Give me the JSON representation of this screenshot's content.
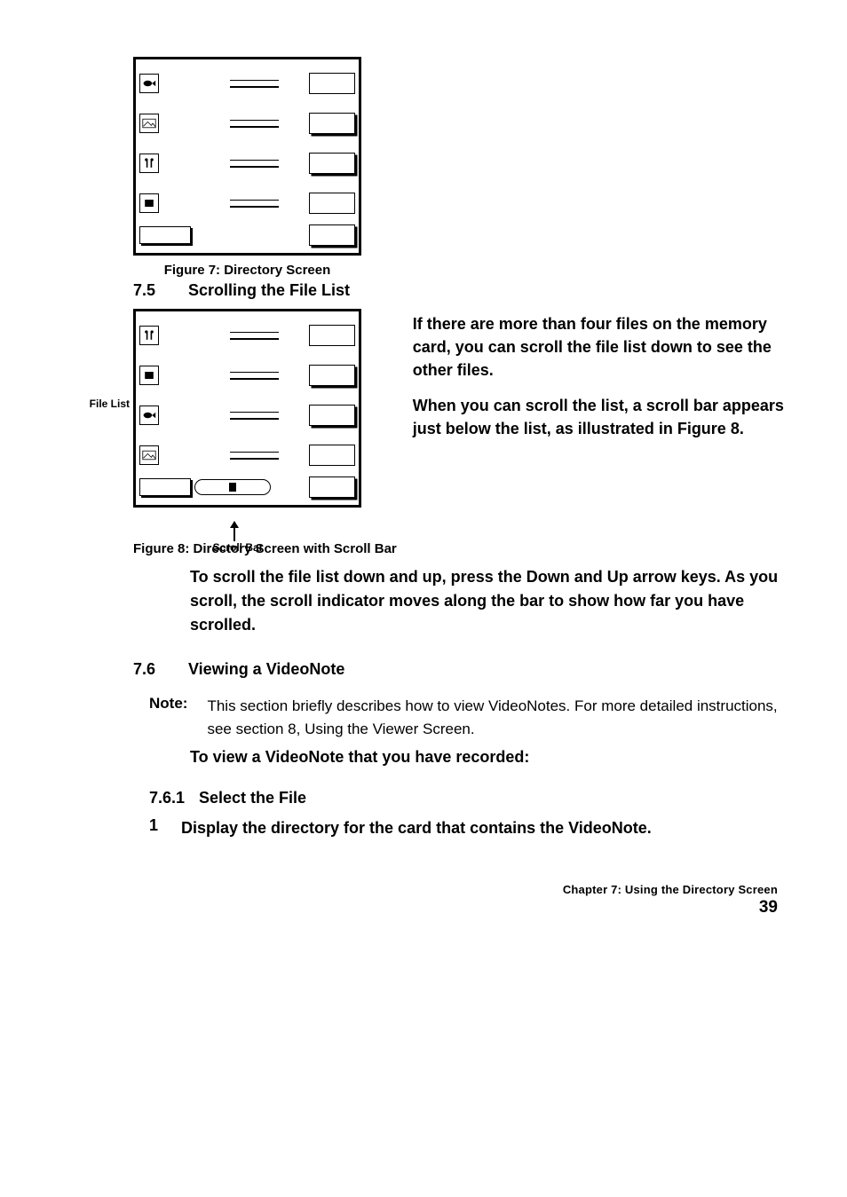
{
  "figure1": {
    "caption": "Figure 7:  Directory Screen"
  },
  "figure2": {
    "caption": "Figure 8:  Directory Screen with Scroll Bar",
    "label": "File List",
    "annotation": "Scroll Bar"
  },
  "s75": {
    "num": "7.5",
    "title": "Scrolling the File List",
    "p1": "If there are more than four files on the memory card, you can scroll the file list down to see the other files.",
    "p2": "When you can scroll the list, a scroll bar appears just below the list, as illustrated in Figure 8."
  },
  "scroll_instr": "To scroll the file list down and up, press the Down and Up arrow keys. As you scroll, the scroll indicator moves along the bar to show how far you have scrolled.",
  "s76": {
    "num": "7.6",
    "title": "Viewing a VideoNote",
    "note_head": "Note:",
    "note_body": "This section briefly describes how to view VideoNotes. For more detailed instructions, see section 8, Using the Viewer Screen.",
    "lead": "To view a VideoNote that you have recorded:",
    "step1": "Display the directory for the card that contains the VideoNote."
  },
  "s761": {
    "num": "7.6.1",
    "title": "Select the File"
  },
  "footer": {
    "chapter": "Chapter 7:  Using the Directory Screen",
    "page": "39"
  }
}
